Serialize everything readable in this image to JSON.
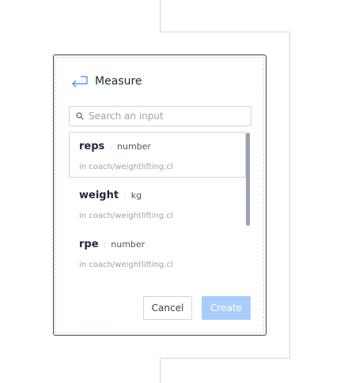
{
  "dialog": {
    "title": "Measure",
    "icon": "enter-arrow-icon"
  },
  "search": {
    "placeholder": "Search an input",
    "value": ""
  },
  "items": [
    {
      "name": "reps",
      "separator": ":",
      "type": "number",
      "location": "in coach/weightlifting.cl",
      "selected": true
    },
    {
      "name": "weight",
      "separator": ":",
      "type": "kg",
      "location": "in coach/weightlifting.cl",
      "selected": false
    },
    {
      "name": "rpe",
      "separator": ":",
      "type": "number",
      "location": "in coach/weightlifting.cl",
      "selected": false
    }
  ],
  "actions": {
    "cancel_label": "Cancel",
    "create_label": "Create"
  },
  "colors": {
    "accent_disabled": "#a9cdfa",
    "icon_blue": "#3b82f6",
    "border": "#d1d5db",
    "dialog_border": "#374151"
  }
}
